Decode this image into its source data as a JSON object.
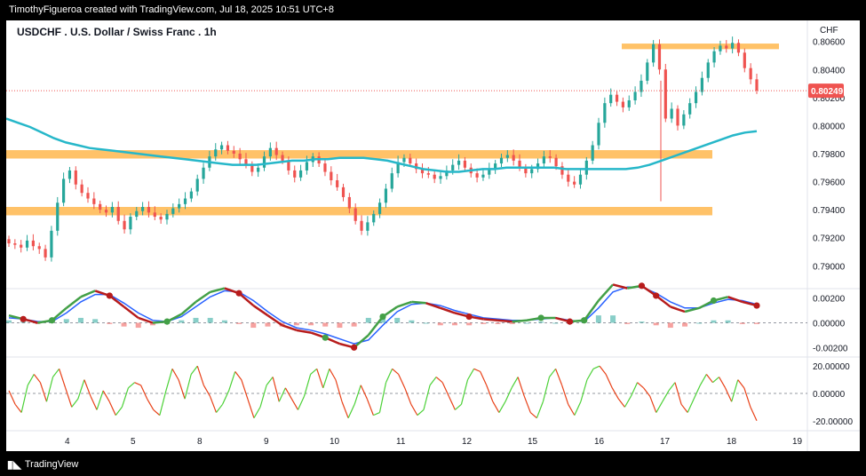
{
  "header_text": "TimothyFigueroa created with TradingView.com, Jul 18, 2025 10:51 UTC+8",
  "footer_text": "TradingView",
  "colors": {
    "up": "#26a69a",
    "down": "#ef5350",
    "ma": "#26b7c9",
    "ma_green": "#4caf50",
    "zone": "#ffb74d",
    "price_line": "#ef5350",
    "wave_blue": "#2962ff",
    "wave_green": "#43a047",
    "wave_red": "#b71c1c",
    "osc_green": "#4cd137",
    "osc_red": "#e84118"
  },
  "chart_data": [
    {
      "type": "candlestick",
      "title": "USDCHF . U.S. Dollar / Swiss Franc . 1h",
      "currency_label": "CHF",
      "y_ticks": [
        "0.80600",
        "0.80400",
        "0.80200",
        "0.80000",
        "0.79800",
        "0.79600",
        "0.79400",
        "0.79200",
        "0.79000"
      ],
      "ylim": [
        0.7885,
        0.8075
      ],
      "last_price": "0.80249",
      "x_ticks": [
        "4",
        "5",
        "8",
        "9",
        "10",
        "11",
        "12",
        "15",
        "16",
        "17",
        "18",
        "19"
      ],
      "zones": [
        {
          "from": 0.80585,
          "to": 0.80545,
          "start_day": "16",
          "end": "18"
        },
        {
          "from": 0.79825,
          "to": 0.79765,
          "start_day": "3",
          "end": "17"
        },
        {
          "from": 0.7942,
          "to": 0.7936,
          "start_day": "3",
          "end": "17"
        }
      ],
      "close_path": [
        0.7916,
        0.7915,
        0.7913,
        0.7918,
        0.7914,
        0.7912,
        0.7906,
        0.7925,
        0.7945,
        0.7962,
        0.7968,
        0.7958,
        0.7952,
        0.7948,
        0.7944,
        0.794,
        0.7938,
        0.7942,
        0.7932,
        0.7926,
        0.7935,
        0.7939,
        0.7942,
        0.7938,
        0.7935,
        0.7933,
        0.7937,
        0.7941,
        0.7944,
        0.7948,
        0.7953,
        0.7962,
        0.797,
        0.7978,
        0.7983,
        0.7986,
        0.7982,
        0.798,
        0.7976,
        0.7972,
        0.7967,
        0.797,
        0.7978,
        0.7984,
        0.7979,
        0.7975,
        0.7968,
        0.7963,
        0.7968,
        0.7974,
        0.7978,
        0.7973,
        0.7967,
        0.7961,
        0.7956,
        0.7949,
        0.7941,
        0.7932,
        0.7925,
        0.7931,
        0.7937,
        0.7945,
        0.7955,
        0.7966,
        0.7974,
        0.7977,
        0.7973,
        0.7969,
        0.7966,
        0.7965,
        0.7962,
        0.7964,
        0.7968,
        0.7972,
        0.7975,
        0.797,
        0.7966,
        0.7963,
        0.7965,
        0.7969,
        0.7973,
        0.7977,
        0.7979,
        0.7975,
        0.797,
        0.7966,
        0.7969,
        0.7973,
        0.7978,
        0.7977,
        0.7971,
        0.7965,
        0.796,
        0.7958,
        0.7965,
        0.7975,
        0.7986,
        0.8002,
        0.8016,
        0.8022,
        0.8017,
        0.8013,
        0.8018,
        0.8024,
        0.8032,
        0.8045,
        0.8058,
        0.804,
        0.8005,
        0.8012,
        0.8,
        0.8008,
        0.8016,
        0.8024,
        0.8034,
        0.8045,
        0.8053,
        0.8057,
        0.8055,
        0.8059,
        0.8052,
        0.8041,
        0.8033,
        0.8025
      ],
      "moving_average_path": [
        0.8005,
        0.8002,
        0.7999,
        0.7995,
        0.7991,
        0.7988,
        0.7986,
        0.7984,
        0.7983,
        0.7982,
        0.7981,
        0.798,
        0.7979,
        0.7978,
        0.7977,
        0.7976,
        0.7975,
        0.7974,
        0.7973,
        0.7972,
        0.7972,
        0.7972,
        0.7973,
        0.7974,
        0.7975,
        0.7975,
        0.7976,
        0.7976,
        0.7977,
        0.7977,
        0.7977,
        0.7976,
        0.7975,
        0.7973,
        0.7971,
        0.7969,
        0.7968,
        0.7967,
        0.7967,
        0.7968,
        0.7969,
        0.7969,
        0.797,
        0.797,
        0.797,
        0.797,
        0.797,
        0.7969,
        0.7969,
        0.7969,
        0.7969,
        0.7969,
        0.7969,
        0.797,
        0.7972,
        0.7975,
        0.7978,
        0.7981,
        0.7984,
        0.7987,
        0.799,
        0.7993,
        0.7995,
        0.7996
      ]
    },
    {
      "type": "line",
      "y_ticks": [
        "0.00200",
        "0.00000",
        "-0.00200"
      ],
      "ylim": [
        -0.0027,
        0.0027
      ],
      "series": [
        {
          "values": [
            0.0006,
            0.0003,
            0.0,
            0.0002,
            0.0012,
            0.0021,
            0.0026,
            0.0022,
            0.0013,
            0.0004,
            0.0,
            0.0001,
            0.0007,
            0.0017,
            0.0025,
            0.0028,
            0.0024,
            0.0014,
            0.0006,
            -0.0002,
            -0.0006,
            -0.0008,
            -0.0012,
            -0.0017,
            -0.002,
            -0.001,
            0.0005,
            0.0013,
            0.0017,
            0.0016,
            0.0012,
            0.0008,
            0.0005,
            0.0003,
            0.0002,
            0.0001,
            0.0002,
            0.0004,
            0.0004,
            0.0001,
            0.0002,
            0.0018,
            0.0031,
            0.0028,
            0.003,
            0.0022,
            0.0013,
            0.0009,
            0.0012,
            0.0018,
            0.0021,
            0.0017,
            0.0014
          ]
        },
        {
          "values": [
            0.0004,
            0.0003,
            0.0001,
            0.0001,
            0.0008,
            0.0017,
            0.0023,
            0.0023,
            0.0016,
            0.0008,
            0.0002,
            0.0001,
            0.0005,
            0.0013,
            0.0021,
            0.0026,
            0.0025,
            0.0018,
            0.0009,
            0.0001,
            -0.0004,
            -0.0006,
            -0.0009,
            -0.0013,
            -0.0017,
            -0.0014,
            -0.0002,
            0.0009,
            0.0015,
            0.0016,
            0.0014,
            0.001,
            0.0007,
            0.0004,
            0.0003,
            0.0002,
            0.0002,
            0.0003,
            0.0004,
            0.0002,
            0.0001,
            0.0012,
            0.0025,
            0.0029,
            0.0029,
            0.0024,
            0.0017,
            0.0012,
            0.0012,
            0.0016,
            0.0019,
            0.0018,
            0.0015
          ]
        }
      ],
      "histogram": [
        0.0002,
        0.0001,
        -0.0001,
        0.0001,
        0.0003,
        0.0004,
        0.0003,
        -0.0001,
        -0.0003,
        -0.0004,
        -0.0002,
        0.0,
        0.0002,
        0.0004,
        0.0004,
        0.0002,
        -0.0001,
        -0.0004,
        -0.0003,
        -0.0003,
        -0.0002,
        -0.0002,
        -0.0003,
        -0.0004,
        -0.0003,
        0.0004,
        0.0007,
        0.0004,
        0.0002,
        0.0,
        -0.0002,
        -0.0002,
        -0.0002,
        -0.0001,
        -0.0001,
        -0.0001,
        0.0,
        0.0001,
        0.0,
        -0.0001,
        0.0001,
        0.0006,
        0.0006,
        -0.0001,
        0.0001,
        -0.0002,
        -0.0004,
        -0.0003,
        0.0,
        0.0002,
        0.0002,
        -0.0001,
        -0.0001
      ],
      "cross_markers": [
        {
          "index": 1,
          "kind": "down"
        },
        {
          "index": 3,
          "kind": "up"
        },
        {
          "index": 7,
          "kind": "down"
        },
        {
          "index": 11,
          "kind": "up"
        },
        {
          "index": 16,
          "kind": "down"
        },
        {
          "index": 22,
          "kind": "up"
        },
        {
          "index": 24,
          "kind": "down"
        },
        {
          "index": 26,
          "kind": "up"
        },
        {
          "index": 32,
          "kind": "down"
        },
        {
          "index": 37,
          "kind": "up"
        },
        {
          "index": 39,
          "kind": "down"
        },
        {
          "index": 40,
          "kind": "up"
        },
        {
          "index": 44,
          "kind": "down"
        },
        {
          "index": 45,
          "kind": "down"
        },
        {
          "index": 49,
          "kind": "up"
        },
        {
          "index": 52,
          "kind": "down"
        }
      ]
    },
    {
      "type": "line",
      "y_ticks": [
        "20.00000",
        "0.00000",
        "-20.00000"
      ],
      "ylim": [
        -26,
        26
      ],
      "values": [
        2,
        -8,
        -14,
        6,
        14,
        8,
        -6,
        12,
        18,
        4,
        -10,
        -4,
        10,
        -2,
        -12,
        2,
        -6,
        -16,
        -10,
        4,
        8,
        6,
        -4,
        -12,
        -16,
        2,
        18,
        10,
        -4,
        14,
        20,
        6,
        -2,
        -14,
        -8,
        2,
        16,
        10,
        -4,
        -18,
        -10,
        6,
        12,
        -6,
        4,
        -4,
        -12,
        -2,
        14,
        18,
        4,
        18,
        10,
        -6,
        -18,
        -8,
        6,
        -4,
        -16,
        -14,
        8,
        18,
        14,
        4,
        -8,
        -16,
        -12,
        6,
        12,
        8,
        -2,
        -12,
        -8,
        10,
        18,
        16,
        6,
        -6,
        -14,
        -6,
        4,
        12,
        -2,
        -14,
        -18,
        -6,
        12,
        18,
        6,
        -8,
        -16,
        -6,
        10,
        18,
        20,
        14,
        4,
        -4,
        -10,
        -2,
        8,
        4,
        -2,
        -14,
        -6,
        2,
        8,
        -8,
        -14,
        -4,
        6,
        14,
        8,
        12,
        4,
        -6,
        10,
        4,
        -10,
        -20
      ]
    }
  ]
}
